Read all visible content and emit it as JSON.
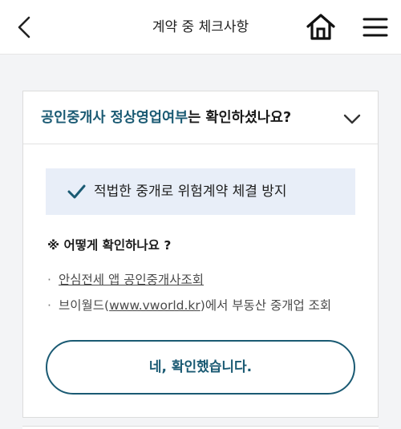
{
  "header": {
    "title": "계약 중 체크사항",
    "back_icon": "chevron-left-icon",
    "home_icon": "home-icon",
    "menu_icon": "hamburger-menu-icon"
  },
  "card": {
    "question_highlight": "공인중개사 정상영업여부",
    "question_rest": "는 확인하셨나요?",
    "expand_icon": "chevron-down-icon",
    "info_text": "적법한 중개로 위험계약 체결 방지",
    "how_title": "※ 어떻게 확인하나요 ?",
    "list": [
      {
        "bullet": "·",
        "link": "안심전세 앱 공인중개사조회"
      },
      {
        "bullet": "·",
        "prefix": "브이월드(",
        "link": "www.vworld.kr",
        "suffix": ")에서 부동산 중개업 조회"
      }
    ],
    "confirm_label": "네, 확인했습니다."
  },
  "colors": {
    "accent": "#1a5a73",
    "info_bg": "#e8eef8",
    "page_bg": "#f3f4f6"
  }
}
